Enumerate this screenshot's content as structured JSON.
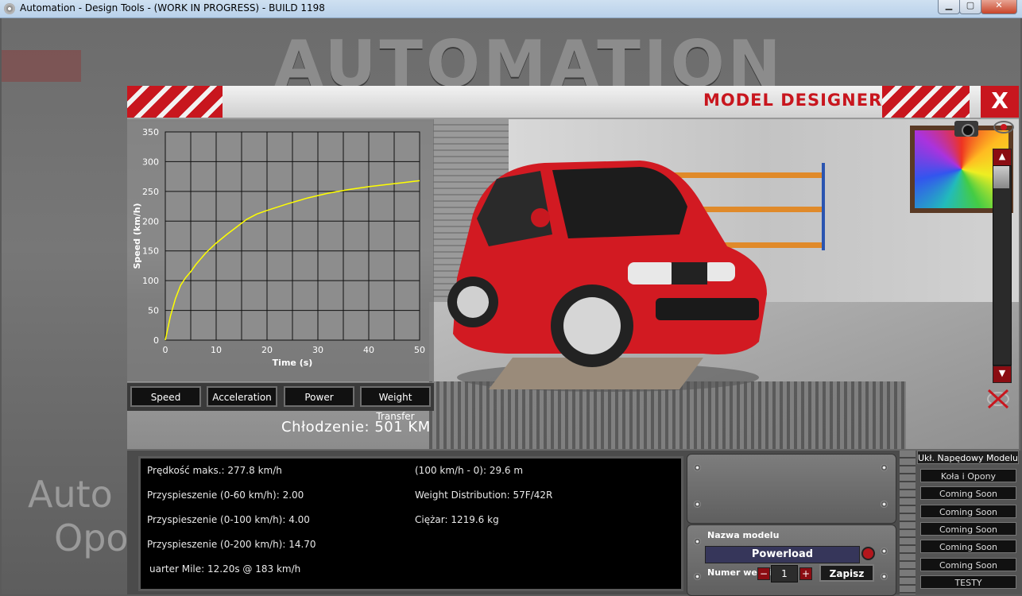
{
  "window": {
    "title": "Automation - Design Tools - (WORK IN PROGRESS) - BUILD 1198"
  },
  "background": {
    "logo": "AUTOMATION",
    "left_text_1": "Auto",
    "left_text_2": "Opo"
  },
  "header": {
    "title": "MODEL DESIGNER",
    "close_label": "X"
  },
  "colors": {
    "accent_red": "#c8161e",
    "plot_line": "#ffff00",
    "panel_black": "#000000"
  },
  "chart_data": {
    "type": "line",
    "xlabel": "Time (s)",
    "ylabel": "Speed (km/h)",
    "xlim": [
      0,
      50
    ],
    "ylim": [
      0,
      350
    ],
    "xticks": [
      0,
      10,
      20,
      30,
      40,
      50
    ],
    "yticks": [
      0,
      50,
      100,
      150,
      200,
      250,
      300,
      350
    ],
    "grid": true,
    "x": [
      0,
      1,
      2,
      3,
      4,
      5,
      6,
      8,
      10,
      12,
      14,
      16,
      18,
      20,
      24,
      28,
      32,
      36,
      40,
      44,
      48,
      50
    ],
    "y": [
      0,
      40,
      70,
      92,
      105,
      115,
      127,
      147,
      163,
      177,
      190,
      203,
      212,
      218,
      229,
      239,
      247,
      253,
      258,
      262,
      266,
      268
    ]
  },
  "chart_tabs": [
    "Speed",
    "Acceleration",
    "Power",
    "Weight Transfer"
  ],
  "cooling": {
    "label": "Chłodzenie:",
    "value": "501 KM"
  },
  "stats": {
    "top_speed": "Prędkość maks.: 277.8 km/h",
    "accel_60": "Przyspieszenie (0-60 km/h): 2.00",
    "accel_100": "Przyspieszenie (0-100 km/h): 4.00",
    "accel_200": "Przyspieszenie (0-200 km/h): 14.70",
    "quarter_mile": "uarter Mile: 12.20s @ 183 km/h",
    "braking": "(100 km/h - 0): 29.6 m",
    "weight_distribution": "Weight Distribution: 57F/42R",
    "weight": "Ciężar: 1219.6 kg"
  },
  "model": {
    "name_label": "Nazwa modelu",
    "name_value": "Powerload",
    "version_label": "Numer wersji",
    "version_value": "1",
    "minus_label": "−",
    "plus_label": "+",
    "save_label": "Zapisz"
  },
  "menu": {
    "header": "Ukł. Napędowy Modelu",
    "items": [
      "Koła i Opony",
      "Coming Soon",
      "Coming Soon",
      "Coming Soon",
      "Coming Soon",
      "Coming Soon",
      "TESTY"
    ]
  }
}
